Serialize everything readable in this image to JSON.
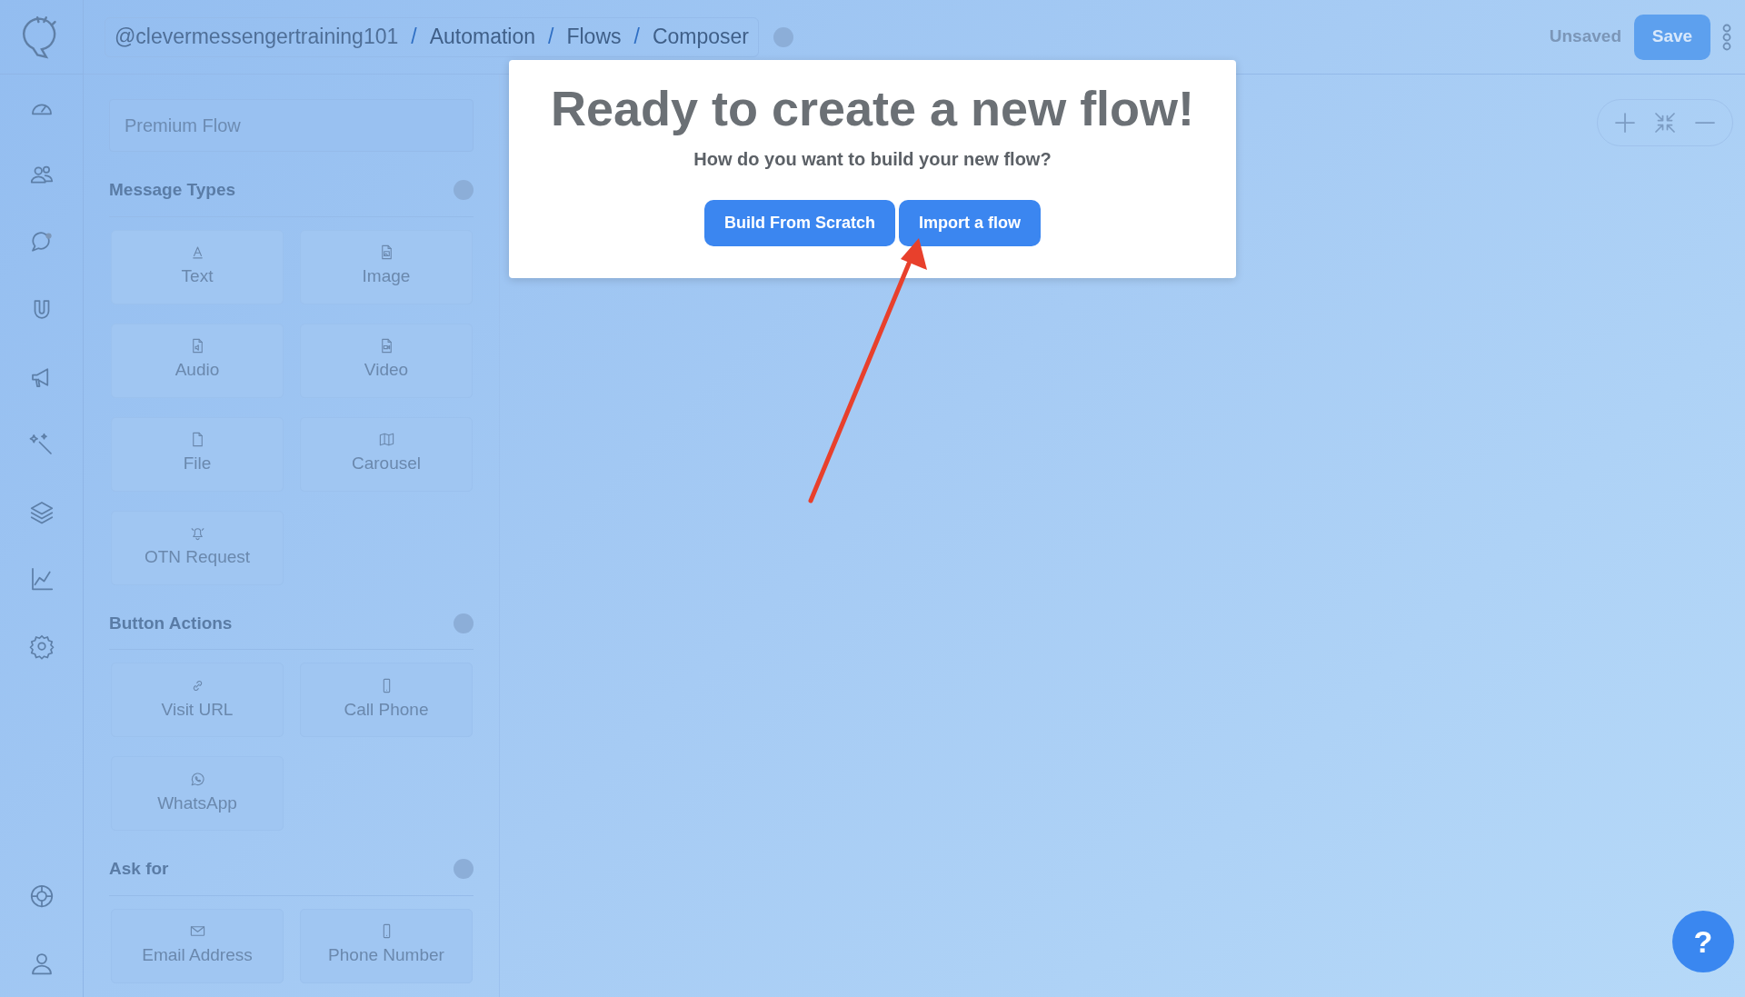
{
  "breadcrumb": [
    "@clevermessengertraining101",
    "Automation",
    "Flows",
    "Composer"
  ],
  "breadcrumb_separators": [
    "/",
    "/",
    "/"
  ],
  "unsaved_label": "Unsaved",
  "save_button": "Save",
  "flow_name": {
    "value": "Premium Flow"
  },
  "sections": [
    {
      "title": "Message Types",
      "items": [
        {
          "label": "Text",
          "kind": "text"
        },
        {
          "label": "Image",
          "kind": "image"
        },
        {
          "label": "Audio",
          "kind": "audio"
        },
        {
          "label": "Video",
          "kind": "video"
        },
        {
          "label": "File",
          "kind": "file"
        },
        {
          "label": "Carousel",
          "kind": "carousel"
        },
        {
          "label": "OTN Request",
          "kind": "bell"
        }
      ]
    },
    {
      "title": "Button Actions",
      "items": [
        {
          "label": "Visit URL",
          "kind": "link"
        },
        {
          "label": "Call Phone",
          "kind": "phone"
        },
        {
          "label": "WhatsApp",
          "kind": "whatsapp"
        }
      ]
    },
    {
      "title": "Ask for",
      "items": [
        {
          "label": "Email Address",
          "kind": "email"
        },
        {
          "label": "Phone Number",
          "kind": "phone"
        }
      ]
    }
  ],
  "modal": {
    "title": "Ready to create a new flow!",
    "subtitle": "How do you want to build your new flow?",
    "buttons": [
      "Build From Scratch",
      "Import a flow"
    ]
  },
  "help_button": "?"
}
